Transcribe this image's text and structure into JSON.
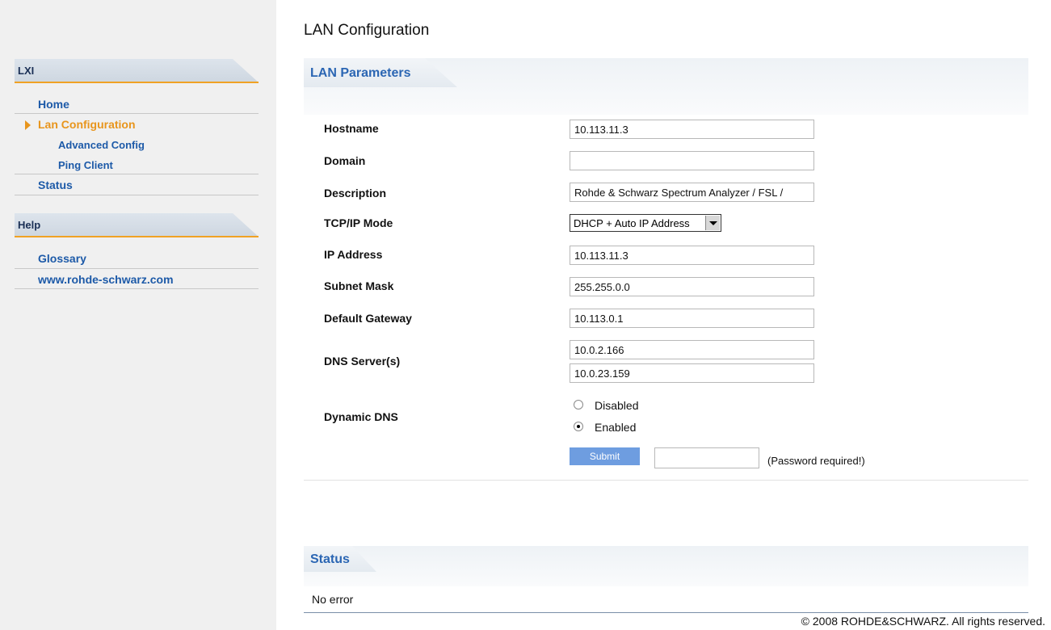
{
  "sidebar": {
    "lxi_header": "LXI",
    "help_header": "Help",
    "items": {
      "home": "Home",
      "lan_configuration": "Lan Configuration",
      "advanced_config": "Advanced Config",
      "ping_client": "Ping Client",
      "status": "Status",
      "glossary": "Glossary",
      "website": "www.rohde-schwarz.com"
    },
    "accent_color": "#e8951c",
    "link_color": "#1d5aa8"
  },
  "page": {
    "title": "LAN Configuration"
  },
  "lan_parameters": {
    "tab_label": "LAN Parameters",
    "fields": {
      "hostname": {
        "label": "Hostname",
        "value": "10.113.11.3"
      },
      "domain": {
        "label": "Domain",
        "value": ""
      },
      "description": {
        "label": "Description",
        "value": "Rohde & Schwarz Spectrum Analyzer / FSL /"
      },
      "tcpip_mode": {
        "label": "TCP/IP Mode",
        "value": "DHCP + Auto IP Address"
      },
      "ip_address": {
        "label": "IP Address",
        "value": "10.113.11.3"
      },
      "subnet_mask": {
        "label": "Subnet Mask",
        "value": "255.255.0.0"
      },
      "default_gateway": {
        "label": "Default Gateway",
        "value": "10.113.0.1"
      },
      "dns_servers": {
        "label": "DNS Server(s)",
        "primary": "10.0.2.166",
        "secondary": "10.0.23.159"
      },
      "dynamic_dns": {
        "label": "Dynamic DNS",
        "option_disabled": "Disabled",
        "option_enabled": "Enabled",
        "selected": "Enabled"
      }
    },
    "submit_label": "Submit",
    "password_note": "(Password required!)"
  },
  "status": {
    "tab_label": "Status",
    "text": "No error"
  },
  "footer": {
    "copyright": "© 2008 ROHDE&SCHWARZ. All rights reserved."
  }
}
